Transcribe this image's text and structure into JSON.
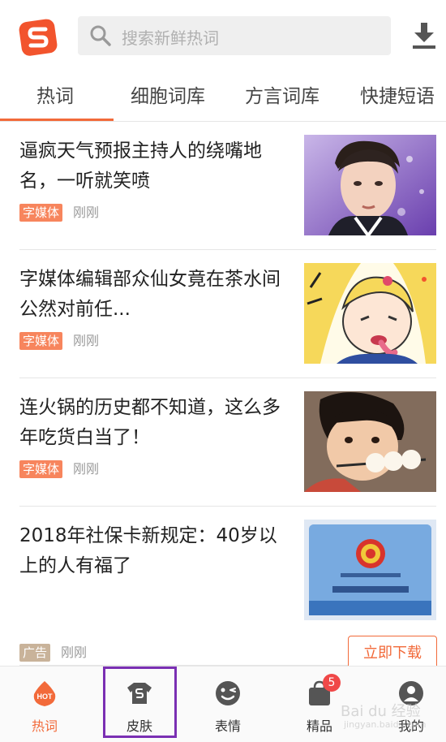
{
  "header": {
    "search_placeholder": "搜索新鲜热词",
    "brand_color": "#f26a3a"
  },
  "tabs": [
    {
      "label": "热词",
      "active": true
    },
    {
      "label": "细胞词库",
      "active": false
    },
    {
      "label": "方言词库",
      "active": false
    },
    {
      "label": "快捷短语",
      "active": false
    }
  ],
  "feed": [
    {
      "title": "逼疯天气预报主持人的绕嘴地名，一听就笑喷",
      "tag": "字媒体",
      "time": "刚刚",
      "image": "young-man-portrait"
    },
    {
      "title": "字媒体编辑部众仙女竟在茶水间公然对前任...",
      "tag": "字媒体",
      "time": "刚刚",
      "image": "cartoon-sailor-girl"
    },
    {
      "title": "连火锅的历史都不知道，这么多年吃货白当了！",
      "tag": "字媒体",
      "time": "刚刚",
      "image": "child-eating-dumplings"
    },
    {
      "title": "2018年社保卡新规定：40岁以上的人有福了",
      "image": "social-security-card"
    }
  ],
  "ad": {
    "tag": "广告",
    "time": "刚刚",
    "button": "立即下载"
  },
  "bottom_nav": [
    {
      "label": "热词",
      "icon": "hot-icon",
      "active": true,
      "badge_text": "HOT"
    },
    {
      "label": "皮肤",
      "icon": "skin-shirt-icon",
      "active": false
    },
    {
      "label": "表情",
      "icon": "emoji-wink-icon",
      "active": false
    },
    {
      "label": "精品",
      "icon": "shopping-bag-icon",
      "active": false,
      "badge": "5"
    },
    {
      "label": "我的",
      "icon": "profile-icon",
      "active": false
    }
  ],
  "watermark": {
    "main": "Bai du 经验",
    "sub": "jingyan.baidu.com"
  }
}
